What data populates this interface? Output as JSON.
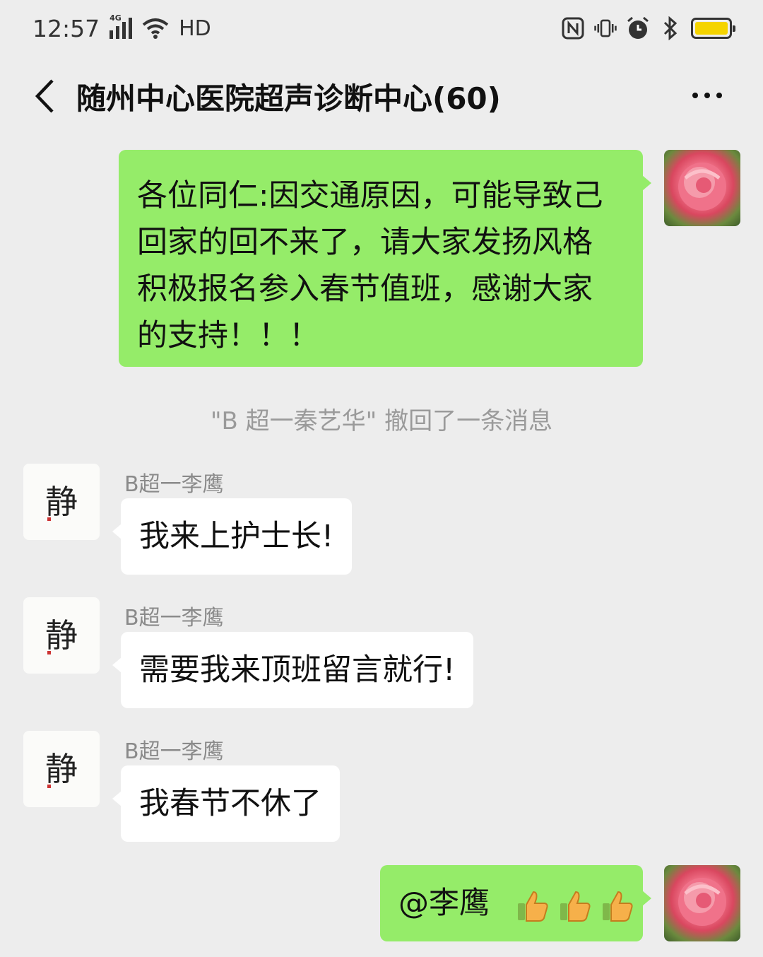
{
  "status_bar": {
    "time": "12:57",
    "network": "4G",
    "hd": "HD",
    "icons": [
      "nfc-icon",
      "vibrate-icon",
      "alarm-icon",
      "bluetooth-icon",
      "battery-icon"
    ]
  },
  "header": {
    "title": "随州中心医院超声诊断中心(60)",
    "back_icon": "chevron-left-icon",
    "more_icon": "more-dots-icon"
  },
  "messages": [
    {
      "side": "me",
      "avatar": "rose-avatar",
      "lines": [
        "各位同仁:因交通原因，可能导致己",
        "回家的回不来了，请大家发扬风格",
        "积极报名参入春节值班，感谢大家",
        "的支持！！！"
      ]
    },
    {
      "type": "system",
      "text": "\"B 超一秦艺华\" 撤回了一条消息"
    },
    {
      "side": "other",
      "sender": "B超一李鹰",
      "avatar": "calligraphy-avatar",
      "text": "我来上护士长!"
    },
    {
      "side": "other",
      "sender": "B超一李鹰",
      "avatar": "calligraphy-avatar",
      "text": "需要我来顶班留言就行!"
    },
    {
      "side": "other",
      "sender": "B超一李鹰",
      "avatar": "calligraphy-avatar",
      "text": "我春节不休了"
    },
    {
      "side": "me",
      "avatar": "rose-avatar",
      "text": "@李鹰",
      "emoji": [
        "thumbs-up-icon",
        "thumbs-up-icon",
        "thumbs-up-icon"
      ]
    }
  ],
  "avatar_glyph": "静",
  "colors": {
    "background": "#ededed",
    "my_bubble": "#95ec69",
    "other_bubble": "#ffffff",
    "battery": "#f5d400"
  }
}
